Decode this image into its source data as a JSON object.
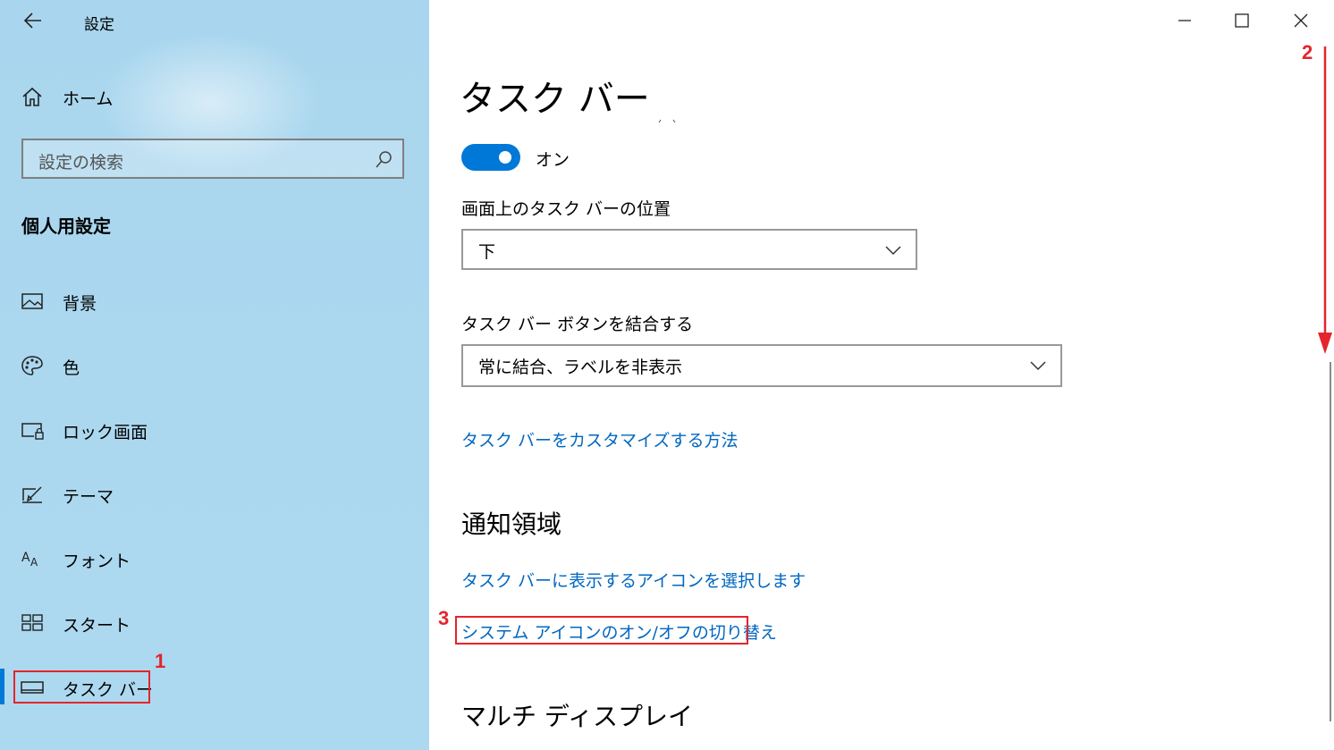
{
  "window": {
    "title": "設定"
  },
  "sidebar": {
    "home_label": "ホーム",
    "search_placeholder": "設定の検索",
    "section_title": "個人用設定",
    "items": [
      {
        "label": "背景",
        "icon": "image-icon"
      },
      {
        "label": "色",
        "icon": "palette-icon"
      },
      {
        "label": "ロック画面",
        "icon": "lock-screen-icon"
      },
      {
        "label": "テーマ",
        "icon": "theme-brush-icon"
      },
      {
        "label": "フォント",
        "icon": "font-icon"
      },
      {
        "label": "スタート",
        "icon": "start-tiles-icon"
      },
      {
        "label": "タスク バー",
        "icon": "taskbar-icon",
        "selected": true
      }
    ]
  },
  "main": {
    "title": "タスク バー",
    "toggle": {
      "state_label": "オン",
      "on": true
    },
    "position": {
      "label": "画面上のタスク バーの位置",
      "value": "下"
    },
    "combine": {
      "label": "タスク バー ボタンを結合する",
      "value": "常に結合、ラベルを非表示"
    },
    "customize_link": "タスク バーをカスタマイズする方法",
    "notification_area": {
      "heading": "通知領域",
      "select_icons_link": "タスク バーに表示するアイコンを選択します",
      "system_icons_link": "システム アイコンのオン/オフの切り替え"
    },
    "multi_display_heading": "マルチ ディスプレイ"
  },
  "annotations": {
    "step1": "1",
    "step2": "2",
    "step3": "3"
  },
  "colors": {
    "accent": "#0078d7",
    "link": "#0067c0",
    "annotation": "#e5242c",
    "sidebar_bg": "#add9f0"
  }
}
